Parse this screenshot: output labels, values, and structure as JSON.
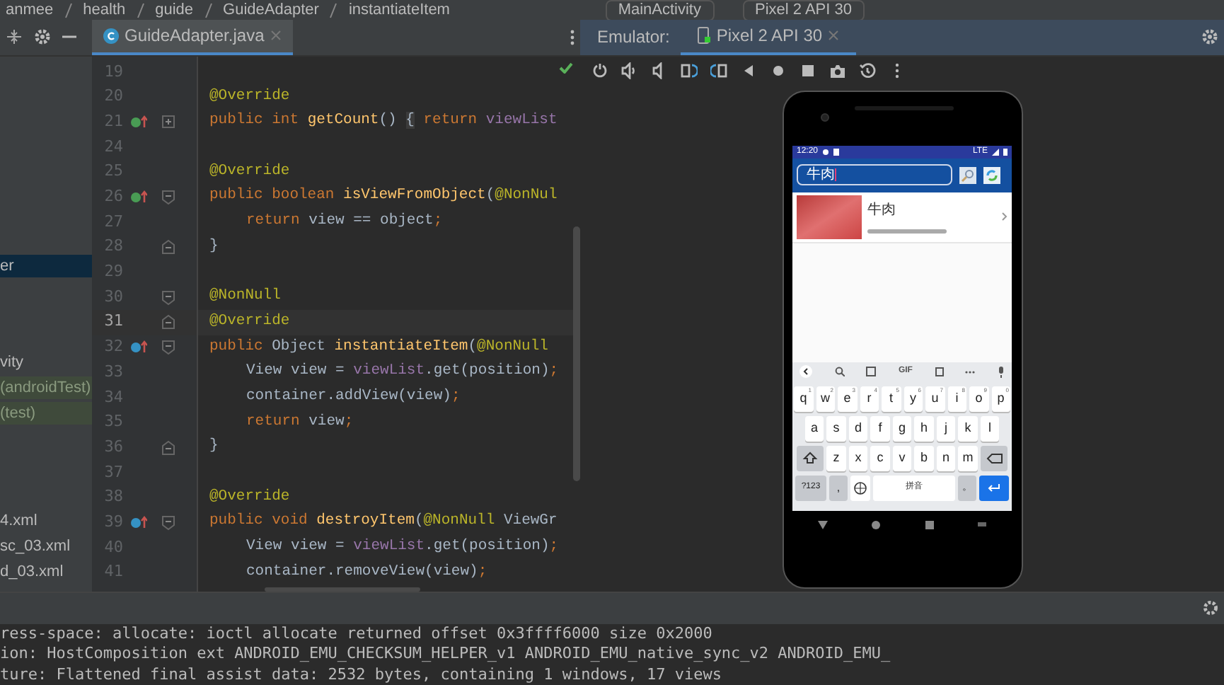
{
  "breadcrumb": [
    "anmee",
    "health",
    "guide",
    "GuideAdapter",
    "instantiateItem"
  ],
  "run_config": "MainActivity",
  "device_selector": "Pixel 2 API 30",
  "editor_tab": {
    "label": "GuideAdapter.java",
    "selected": true
  },
  "emulator_tabs": {
    "label": "Emulator:",
    "device_tab": {
      "label": "Pixel 2 API 30",
      "selected": true
    }
  },
  "project_items": [
    {
      "label": "er",
      "selected": true,
      "kind": "normal"
    },
    {
      "label": "vity",
      "selected": false,
      "kind": "normal"
    },
    {
      "label": "(androidTest)",
      "selected": false,
      "kind": "test"
    },
    {
      "label": "(test)",
      "selected": false,
      "kind": "test"
    },
    {
      "label": "4.xml",
      "selected": false,
      "kind": "normal"
    },
    {
      "label": "sc_03.xml",
      "selected": false,
      "kind": "normal"
    },
    {
      "label": "d_03.xml",
      "selected": false,
      "kind": "normal"
    }
  ],
  "code_lines": [
    {
      "number": "19",
      "current": false
    },
    {
      "number": "20",
      "current": false,
      "tokens": [
        {
          "kind": "annotation",
          "text": "@Override"
        }
      ]
    },
    {
      "number": "21",
      "current": false,
      "marker": {
        "kind": "implement"
      },
      "fold": {
        "kind": "collapsed"
      },
      "tokens": [
        {
          "kind": "keyword",
          "text": "public int "
        },
        {
          "kind": "method",
          "text": "getCount"
        },
        {
          "kind": "plain",
          "text": "() "
        },
        {
          "kind": "folded",
          "text": "{"
        },
        {
          "kind": "keyword",
          "text": " return "
        },
        {
          "kind": "field",
          "text": "viewList"
        }
      ]
    },
    {
      "number": "24",
      "current": false
    },
    {
      "number": "25",
      "current": false,
      "tokens": [
        {
          "kind": "annotation",
          "text": "@Override"
        }
      ]
    },
    {
      "number": "26",
      "current": false,
      "marker": {
        "kind": "implement"
      },
      "fold": {
        "kind": "start"
      },
      "tokens": [
        {
          "kind": "keyword",
          "text": "public boolean "
        },
        {
          "kind": "method",
          "text": "isViewFromObject"
        },
        {
          "kind": "plain",
          "text": "("
        },
        {
          "kind": "annotation",
          "text": "@NonNul"
        }
      ]
    },
    {
      "number": "27",
      "current": false,
      "indent": true,
      "tokens": [
        {
          "kind": "keyword",
          "text": "return "
        },
        {
          "kind": "plain",
          "text": "view == object"
        },
        {
          "kind": "keyword",
          "text": ";"
        }
      ]
    },
    {
      "number": "28",
      "current": false,
      "fold": {
        "kind": "end"
      },
      "tokens": [
        {
          "kind": "plain",
          "text": "}"
        }
      ]
    },
    {
      "number": "29",
      "current": false
    },
    {
      "number": "30",
      "current": false,
      "fold": {
        "kind": "start"
      },
      "tokens": [
        {
          "kind": "annotation",
          "text": "@NonNull"
        }
      ]
    },
    {
      "number": "31",
      "current": true,
      "fold": {
        "kind": "end"
      },
      "tokens": [
        {
          "kind": "annotation",
          "text": "@Override"
        }
      ]
    },
    {
      "number": "32",
      "current": false,
      "marker": {
        "kind": "override"
      },
      "fold": {
        "kind": "start"
      },
      "tokens": [
        {
          "kind": "keyword",
          "text": "public "
        },
        {
          "kind": "plain",
          "text": "Object "
        },
        {
          "kind": "method",
          "text": "instantiateItem"
        },
        {
          "kind": "plain",
          "text": "("
        },
        {
          "kind": "annotation",
          "text": "@NonNull"
        }
      ]
    },
    {
      "number": "33",
      "current": false,
      "indent": true,
      "tokens": [
        {
          "kind": "plain",
          "text": "View view = "
        },
        {
          "kind": "field",
          "text": "viewList"
        },
        {
          "kind": "plain",
          "text": ".get(position)"
        },
        {
          "kind": "keyword",
          "text": ";"
        }
      ]
    },
    {
      "number": "34",
      "current": false,
      "indent": true,
      "tokens": [
        {
          "kind": "plain",
          "text": "container.addView(view)"
        },
        {
          "kind": "keyword",
          "text": ";"
        }
      ]
    },
    {
      "number": "35",
      "current": false,
      "indent": true,
      "tokens": [
        {
          "kind": "keyword",
          "text": "return "
        },
        {
          "kind": "plain",
          "text": "view"
        },
        {
          "kind": "keyword",
          "text": ";"
        }
      ]
    },
    {
      "number": "36",
      "current": false,
      "fold": {
        "kind": "end"
      },
      "tokens": [
        {
          "kind": "plain",
          "text": "}"
        }
      ]
    },
    {
      "number": "37",
      "current": false
    },
    {
      "number": "38",
      "current": false,
      "tokens": [
        {
          "kind": "annotation",
          "text": "@Override"
        }
      ]
    },
    {
      "number": "39",
      "current": false,
      "marker": {
        "kind": "override"
      },
      "fold": {
        "kind": "start"
      },
      "tokens": [
        {
          "kind": "keyword",
          "text": "public void "
        },
        {
          "kind": "method",
          "text": "destroyItem"
        },
        {
          "kind": "plain",
          "text": "("
        },
        {
          "kind": "annotation",
          "text": "@NonNull"
        },
        {
          "kind": "plain",
          "text": " ViewGr"
        }
      ]
    },
    {
      "number": "40",
      "current": false,
      "indent": true,
      "tokens": [
        {
          "kind": "plain",
          "text": "View view = "
        },
        {
          "kind": "field",
          "text": "viewList"
        },
        {
          "kind": "plain",
          "text": ".get(position)"
        },
        {
          "kind": "keyword",
          "text": ";"
        }
      ]
    },
    {
      "number": "41",
      "current": false,
      "indent": true,
      "tokens": [
        {
          "kind": "plain",
          "text": "container.removeView(view)"
        },
        {
          "kind": "keyword",
          "text": ";"
        }
      ]
    }
  ],
  "phone": {
    "status_time": "12:20",
    "network": "LTE",
    "search_value": "牛肉",
    "result": {
      "title": "牛肉"
    },
    "keyboard": {
      "toolbar_gif": "GIF",
      "rows": [
        [
          {
            "label": "q",
            "hint": "1"
          },
          {
            "label": "w",
            "hint": "2"
          },
          {
            "label": "e",
            "hint": "3"
          },
          {
            "label": "r",
            "hint": "4"
          },
          {
            "label": "t",
            "hint": "5"
          },
          {
            "label": "y",
            "hint": "6"
          },
          {
            "label": "u",
            "hint": "7"
          },
          {
            "label": "i",
            "hint": "8"
          },
          {
            "label": "o",
            "hint": "9"
          },
          {
            "label": "p",
            "hint": "0"
          }
        ],
        [
          {
            "label": "a"
          },
          {
            "label": "s"
          },
          {
            "label": "d"
          },
          {
            "label": "f"
          },
          {
            "label": "g"
          },
          {
            "label": "h"
          },
          {
            "label": "j"
          },
          {
            "label": "k"
          },
          {
            "label": "l"
          }
        ],
        [
          {
            "label": "z"
          },
          {
            "label": "x"
          },
          {
            "label": "c"
          },
          {
            "label": "v"
          },
          {
            "label": "b"
          },
          {
            "label": "n"
          },
          {
            "label": "m"
          }
        ]
      ],
      "symbols_key": "?123",
      "comma_key": ",",
      "space_key": "拼音",
      "period_key": "。"
    }
  },
  "log_lines": [
    "ress-space: allocate: ioctl allocate returned offset 0x3ffff6000 size 0x2000",
    "ion: HostComposition ext ANDROID_EMU_CHECKSUM_HELPER_v1 ANDROID_EMU_native_sync_v2 ANDROID_EMU_",
    "ture: Flattened final assist data: 2532 bytes, containing 1 windows, 17 views"
  ]
}
